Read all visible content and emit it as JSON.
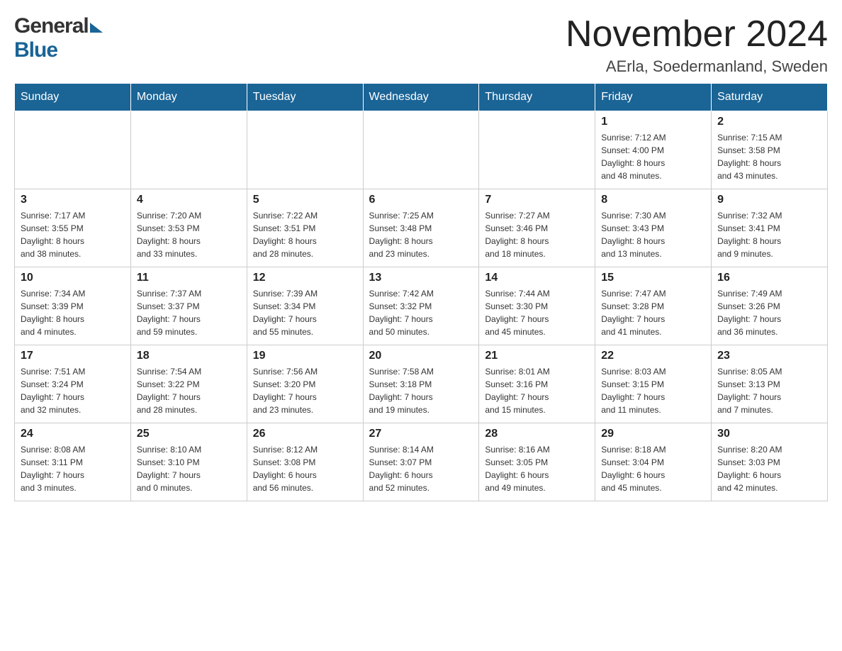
{
  "header": {
    "title": "November 2024",
    "subtitle": "AErla, Soedermanland, Sweden"
  },
  "logo": {
    "line1": "General",
    "line2": "Blue"
  },
  "weekdays": [
    "Sunday",
    "Monday",
    "Tuesday",
    "Wednesday",
    "Thursday",
    "Friday",
    "Saturday"
  ],
  "weeks": [
    [
      {
        "day": "",
        "info": ""
      },
      {
        "day": "",
        "info": ""
      },
      {
        "day": "",
        "info": ""
      },
      {
        "day": "",
        "info": ""
      },
      {
        "day": "",
        "info": ""
      },
      {
        "day": "1",
        "info": "Sunrise: 7:12 AM\nSunset: 4:00 PM\nDaylight: 8 hours\nand 48 minutes."
      },
      {
        "day": "2",
        "info": "Sunrise: 7:15 AM\nSunset: 3:58 PM\nDaylight: 8 hours\nand 43 minutes."
      }
    ],
    [
      {
        "day": "3",
        "info": "Sunrise: 7:17 AM\nSunset: 3:55 PM\nDaylight: 8 hours\nand 38 minutes."
      },
      {
        "day": "4",
        "info": "Sunrise: 7:20 AM\nSunset: 3:53 PM\nDaylight: 8 hours\nand 33 minutes."
      },
      {
        "day": "5",
        "info": "Sunrise: 7:22 AM\nSunset: 3:51 PM\nDaylight: 8 hours\nand 28 minutes."
      },
      {
        "day": "6",
        "info": "Sunrise: 7:25 AM\nSunset: 3:48 PM\nDaylight: 8 hours\nand 23 minutes."
      },
      {
        "day": "7",
        "info": "Sunrise: 7:27 AM\nSunset: 3:46 PM\nDaylight: 8 hours\nand 18 minutes."
      },
      {
        "day": "8",
        "info": "Sunrise: 7:30 AM\nSunset: 3:43 PM\nDaylight: 8 hours\nand 13 minutes."
      },
      {
        "day": "9",
        "info": "Sunrise: 7:32 AM\nSunset: 3:41 PM\nDaylight: 8 hours\nand 9 minutes."
      }
    ],
    [
      {
        "day": "10",
        "info": "Sunrise: 7:34 AM\nSunset: 3:39 PM\nDaylight: 8 hours\nand 4 minutes."
      },
      {
        "day": "11",
        "info": "Sunrise: 7:37 AM\nSunset: 3:37 PM\nDaylight: 7 hours\nand 59 minutes."
      },
      {
        "day": "12",
        "info": "Sunrise: 7:39 AM\nSunset: 3:34 PM\nDaylight: 7 hours\nand 55 minutes."
      },
      {
        "day": "13",
        "info": "Sunrise: 7:42 AM\nSunset: 3:32 PM\nDaylight: 7 hours\nand 50 minutes."
      },
      {
        "day": "14",
        "info": "Sunrise: 7:44 AM\nSunset: 3:30 PM\nDaylight: 7 hours\nand 45 minutes."
      },
      {
        "day": "15",
        "info": "Sunrise: 7:47 AM\nSunset: 3:28 PM\nDaylight: 7 hours\nand 41 minutes."
      },
      {
        "day": "16",
        "info": "Sunrise: 7:49 AM\nSunset: 3:26 PM\nDaylight: 7 hours\nand 36 minutes."
      }
    ],
    [
      {
        "day": "17",
        "info": "Sunrise: 7:51 AM\nSunset: 3:24 PM\nDaylight: 7 hours\nand 32 minutes."
      },
      {
        "day": "18",
        "info": "Sunrise: 7:54 AM\nSunset: 3:22 PM\nDaylight: 7 hours\nand 28 minutes."
      },
      {
        "day": "19",
        "info": "Sunrise: 7:56 AM\nSunset: 3:20 PM\nDaylight: 7 hours\nand 23 minutes."
      },
      {
        "day": "20",
        "info": "Sunrise: 7:58 AM\nSunset: 3:18 PM\nDaylight: 7 hours\nand 19 minutes."
      },
      {
        "day": "21",
        "info": "Sunrise: 8:01 AM\nSunset: 3:16 PM\nDaylight: 7 hours\nand 15 minutes."
      },
      {
        "day": "22",
        "info": "Sunrise: 8:03 AM\nSunset: 3:15 PM\nDaylight: 7 hours\nand 11 minutes."
      },
      {
        "day": "23",
        "info": "Sunrise: 8:05 AM\nSunset: 3:13 PM\nDaylight: 7 hours\nand 7 minutes."
      }
    ],
    [
      {
        "day": "24",
        "info": "Sunrise: 8:08 AM\nSunset: 3:11 PM\nDaylight: 7 hours\nand 3 minutes."
      },
      {
        "day": "25",
        "info": "Sunrise: 8:10 AM\nSunset: 3:10 PM\nDaylight: 7 hours\nand 0 minutes."
      },
      {
        "day": "26",
        "info": "Sunrise: 8:12 AM\nSunset: 3:08 PM\nDaylight: 6 hours\nand 56 minutes."
      },
      {
        "day": "27",
        "info": "Sunrise: 8:14 AM\nSunset: 3:07 PM\nDaylight: 6 hours\nand 52 minutes."
      },
      {
        "day": "28",
        "info": "Sunrise: 8:16 AM\nSunset: 3:05 PM\nDaylight: 6 hours\nand 49 minutes."
      },
      {
        "day": "29",
        "info": "Sunrise: 8:18 AM\nSunset: 3:04 PM\nDaylight: 6 hours\nand 45 minutes."
      },
      {
        "day": "30",
        "info": "Sunrise: 8:20 AM\nSunset: 3:03 PM\nDaylight: 6 hours\nand 42 minutes."
      }
    ]
  ]
}
